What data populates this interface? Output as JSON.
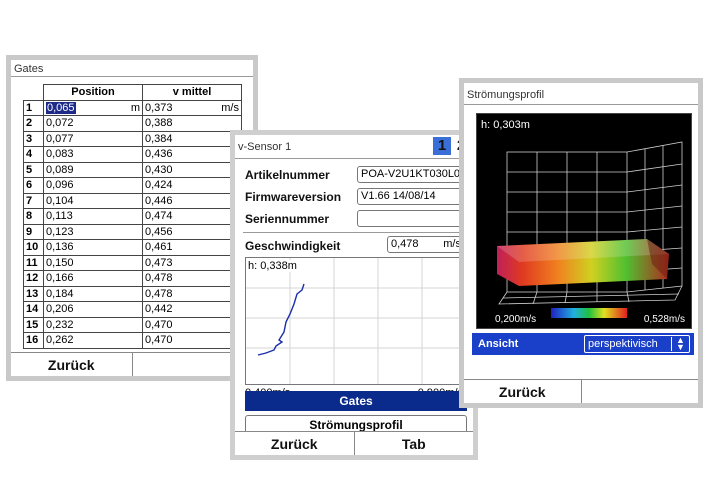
{
  "gates": {
    "title": "Gates",
    "headers": [
      "Position",
      "v mittel"
    ],
    "rows": [
      {
        "n": "1",
        "pos": "0,065",
        "posunit": "m",
        "v": "0,373",
        "vunit": "m/s"
      },
      {
        "n": "2",
        "pos": "0,072",
        "posunit": "",
        "v": "0,388",
        "vunit": ""
      },
      {
        "n": "3",
        "pos": "0,077",
        "posunit": "",
        "v": "0,384",
        "vunit": ""
      },
      {
        "n": "4",
        "pos": "0,083",
        "posunit": "",
        "v": "0,436",
        "vunit": ""
      },
      {
        "n": "5",
        "pos": "0,089",
        "posunit": "",
        "v": "0,430",
        "vunit": ""
      },
      {
        "n": "6",
        "pos": "0,096",
        "posunit": "",
        "v": "0,424",
        "vunit": ""
      },
      {
        "n": "7",
        "pos": "0,104",
        "posunit": "",
        "v": "0,446",
        "vunit": ""
      },
      {
        "n": "8",
        "pos": "0,113",
        "posunit": "",
        "v": "0,474",
        "vunit": ""
      },
      {
        "n": "9",
        "pos": "0,123",
        "posunit": "",
        "v": "0,456",
        "vunit": ""
      },
      {
        "n": "10",
        "pos": "0,136",
        "posunit": "",
        "v": "0,461",
        "vunit": ""
      },
      {
        "n": "11",
        "pos": "0,150",
        "posunit": "",
        "v": "0,473",
        "vunit": ""
      },
      {
        "n": "12",
        "pos": "0,166",
        "posunit": "",
        "v": "0,478",
        "vunit": ""
      },
      {
        "n": "13",
        "pos": "0,184",
        "posunit": "",
        "v": "0,478",
        "vunit": ""
      },
      {
        "n": "14",
        "pos": "0,206",
        "posunit": "",
        "v": "0,442",
        "vunit": ""
      },
      {
        "n": "15",
        "pos": "0,232",
        "posunit": "",
        "v": "0,470",
        "vunit": ""
      },
      {
        "n": "16",
        "pos": "0,262",
        "posunit": "",
        "v": "0,470",
        "vunit": ""
      }
    ],
    "back_label": "Zurück"
  },
  "vsensor": {
    "title": "v-Sensor 1",
    "tab1": "1",
    "tab2": "2",
    "artikel_label": "Artikelnummer",
    "artikel_value": "POA-V2U1KT030L0",
    "firmware_label": "Firmwareversion",
    "firmware_value": "V1.66 14/08/14",
    "serien_label": "Seriennummer",
    "serien_value": "",
    "speed_label": "Geschwindigkeit",
    "speed_value": "0,478",
    "speed_unit": "m/s",
    "plot_height": "h: 0,338m",
    "plot_xmin": "0,400m/s",
    "plot_xmax": "0,900m/s",
    "gates_button": "Gates",
    "profile_button": "Strömungsprofil",
    "back_label": "Zurück",
    "tab_label": "Tab",
    "accent": "#0a2a8c",
    "tab_active_color": "#3a6fd8"
  },
  "profile": {
    "title": "Strömungsprofil",
    "height": "h: 0,303m",
    "scale_min": "0,200m/s",
    "scale_max": "0,528m/s",
    "view_label": "Ansicht",
    "view_value": "perspektivisch",
    "back_label": "Zurück",
    "header_color": "#1a3fc8"
  }
}
